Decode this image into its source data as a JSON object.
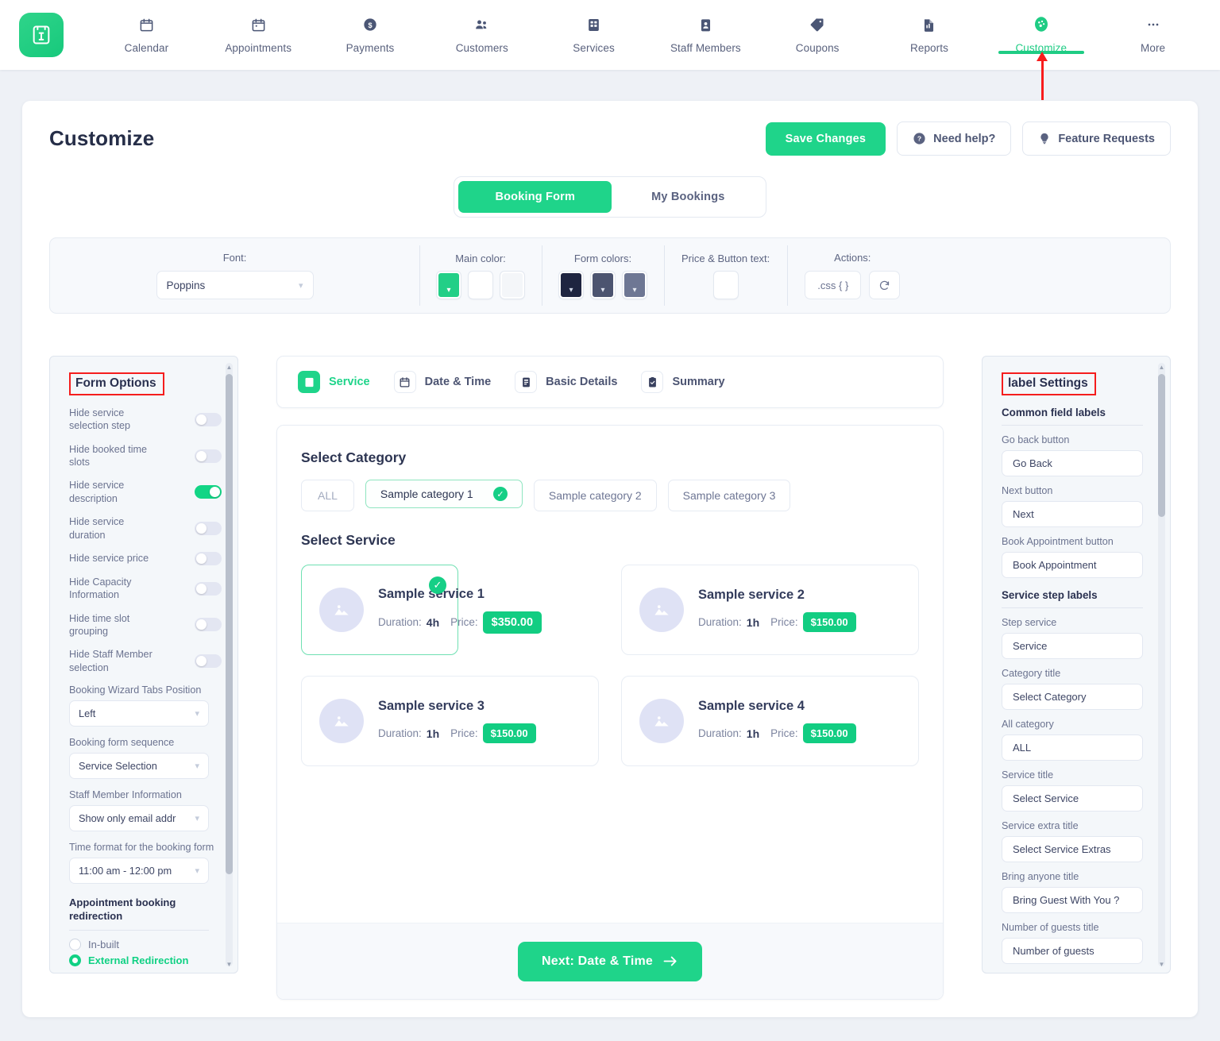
{
  "topnav": {
    "brand_icon": "booking-logo-icon",
    "items": [
      {
        "label": "Calendar",
        "icon": "calendar-icon",
        "active": false
      },
      {
        "label": "Appointments",
        "icon": "appointments-icon",
        "active": false
      },
      {
        "label": "Payments",
        "icon": "payments-dollar-icon",
        "active": false
      },
      {
        "label": "Customers",
        "icon": "customers-people-icon",
        "active": false
      },
      {
        "label": "Services",
        "icon": "services-grid-icon",
        "active": false
      },
      {
        "label": "Staff Members",
        "icon": "staff-badge-icon",
        "active": false
      },
      {
        "label": "Coupons",
        "icon": "coupon-tag-icon",
        "active": false
      },
      {
        "label": "Reports",
        "icon": "reports-document-icon",
        "active": false
      },
      {
        "label": "Customize",
        "icon": "customize-palette-icon",
        "active": true
      },
      {
        "label": "More",
        "icon": "more-dots-icon",
        "active": false
      }
    ]
  },
  "header": {
    "title": "Customize",
    "save_label": "Save Changes",
    "need_help_label": "Need help?",
    "feature_requests_label": "Feature Requests"
  },
  "main_tabs": [
    {
      "label": "Booking Form",
      "active": true
    },
    {
      "label": "My Bookings",
      "active": false
    }
  ],
  "settings_bar": {
    "font_label": "Font:",
    "font_value": "Poppins",
    "main_color_label": "Main color:",
    "main_colors": [
      "#22cf87",
      "#ffffff",
      "#f4f6f9"
    ],
    "form_colors_label": "Form colors:",
    "form_colors": [
      "#1e2440",
      "#4c5470",
      "#6e7794"
    ],
    "price_button_text_label": "Price & Button text:",
    "price_button_text_color": "#ffffff",
    "actions_label": "Actions:",
    "css_button_label": ".css { }",
    "reset_button_label": "↻"
  },
  "left_panel": {
    "title": "Form Options",
    "toggles": [
      {
        "label": "Hide service selection step",
        "on": false
      },
      {
        "label": "Hide booked time slots",
        "on": false
      },
      {
        "label": "Hide service description",
        "on": true
      },
      {
        "label": "Hide service duration",
        "on": false
      },
      {
        "label": "Hide service price",
        "on": false
      },
      {
        "label": "Hide Capacity Information",
        "on": false
      },
      {
        "label": "Hide time slot grouping",
        "on": false
      },
      {
        "label": "Hide Staff Member selection",
        "on": false
      }
    ],
    "selects": [
      {
        "label": "Booking Wizard Tabs Position",
        "value": "Left"
      },
      {
        "label": "Booking form sequence",
        "value": "Service Selection"
      },
      {
        "label": "Staff Member Information",
        "value": "Show only email addr"
      },
      {
        "label": "Time format for the booking form",
        "value": "11:00 am - 12:00 pm"
      }
    ],
    "redirection_heading": "Appointment booking redirection",
    "radios": [
      {
        "label": "In-built",
        "on": false
      },
      {
        "label": "External Redirection",
        "on": true
      }
    ]
  },
  "center": {
    "steps": [
      {
        "label": "Service",
        "icon": "service-list-icon",
        "active": true
      },
      {
        "label": "Date & Time",
        "icon": "calendar-icon",
        "active": false
      },
      {
        "label": "Basic Details",
        "icon": "details-form-icon",
        "active": false
      },
      {
        "label": "Summary",
        "icon": "summary-check-icon",
        "active": false
      }
    ],
    "category_title": "Select Category",
    "categories": [
      {
        "label": "ALL",
        "selected": false,
        "is_all": true
      },
      {
        "label": "Sample category 1",
        "selected": true,
        "is_all": false
      },
      {
        "label": "Sample category 2",
        "selected": false,
        "is_all": false
      },
      {
        "label": "Sample category 3",
        "selected": false,
        "is_all": false
      }
    ],
    "service_title": "Select Service",
    "duration_label": "Duration:",
    "price_label": "Price:",
    "services": [
      {
        "name": "Sample service 1",
        "duration": "4h",
        "price": "$350.00",
        "selected": true
      },
      {
        "name": "Sample service 2",
        "duration": "1h",
        "price": "$150.00",
        "selected": false
      },
      {
        "name": "Sample service 3",
        "duration": "1h",
        "price": "$150.00",
        "selected": false
      },
      {
        "name": "Sample service 4",
        "duration": "1h",
        "price": "$150.00",
        "selected": false
      }
    ],
    "next_button_label": "Next: Date & Time"
  },
  "right_panel": {
    "title": "label Settings",
    "sections": [
      {
        "heading": "Common field labels",
        "fields": [
          {
            "caption": "Go back button",
            "value": "Go Back"
          },
          {
            "caption": "Next button",
            "value": "Next"
          },
          {
            "caption": "Book Appointment button",
            "value": "Book Appointment"
          }
        ]
      },
      {
        "heading": "Service step labels",
        "fields": [
          {
            "caption": "Step service",
            "value": "Service"
          },
          {
            "caption": "Category title",
            "value": "Select Category"
          },
          {
            "caption": "All category",
            "value": "ALL"
          },
          {
            "caption": "Service title",
            "value": "Select Service"
          },
          {
            "caption": "Service extra title",
            "value": "Select Service Extras"
          },
          {
            "caption": "Bring anyone title",
            "value": "Bring Guest With You ?"
          },
          {
            "caption": "Number of guests title",
            "value": "Number of guests"
          }
        ]
      }
    ]
  },
  "colors": {
    "accent": "#1fd48a",
    "highlight_box": "#f51d1d",
    "page_bg": "#eef1f6"
  }
}
